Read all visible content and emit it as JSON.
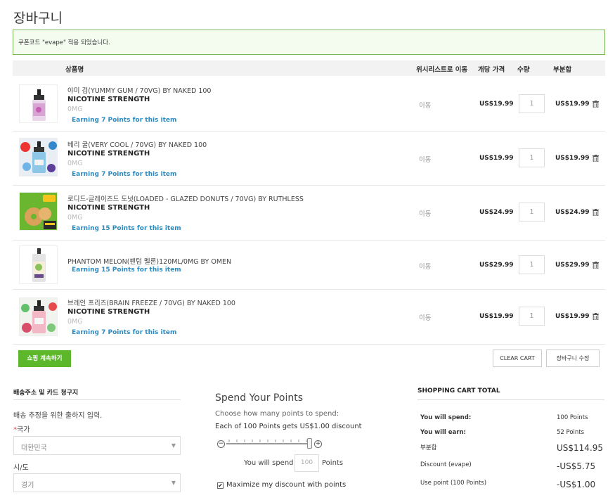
{
  "page": {
    "title": "장바구니"
  },
  "notice": {
    "text": "쿠폰코드 \"evape\" 적용 되었습니다."
  },
  "table": {
    "headers": {
      "product": "상품명",
      "wishlist": "위시리스트로 이동",
      "unit_price": "개당 가격",
      "qty": "수량",
      "subtotal": "부분합"
    }
  },
  "items": [
    {
      "name": "야미 검(YUMMY GUM / 70VG) BY NAKED 100",
      "option_label": "NICOTINE STRENGTH",
      "option_value": "0MG",
      "earn": "Earning 7 Points for this item",
      "move": "이동",
      "price": "US$19.99",
      "qty": "1",
      "subtotal": "US$19.99",
      "image": "pink-gum-bottle"
    },
    {
      "name": "베리 쿨(VERY COOL / 70VG) BY NAKED 100",
      "option_label": "NICOTINE STRENGTH",
      "option_value": "0MG",
      "earn": "Earning 7 Points for this item",
      "move": "이동",
      "price": "US$19.99",
      "qty": "1",
      "subtotal": "US$19.99",
      "image": "very-cool-bottle"
    },
    {
      "name": "로디드-글레이즈드 도넛(LOADED - GLAZED DONUTS / 70VG) BY RUTHLESS",
      "option_label": "NICOTINE STRENGTH",
      "option_value": "0MG",
      "earn": "Earning 15 Points for this item",
      "move": "이동",
      "price": "US$24.99",
      "qty": "1",
      "subtotal": "US$24.99",
      "image": "glazed-donuts-box"
    },
    {
      "name": "PHANTOM MELON(팬텀 멜론)120ML/0MG BY OMEN",
      "option_label": "",
      "option_value": "",
      "earn": "Earning 15 Points for this item",
      "move": "이동",
      "price": "US$29.99",
      "qty": "1",
      "subtotal": "US$29.99",
      "image": "phantom-melon-bottle"
    },
    {
      "name": "브레인 프리즈(BRAIN FREEZE / 70VG) BY NAKED 100",
      "option_label": "NICOTINE STRENGTH",
      "option_value": "0MG",
      "earn": "Earning 7 Points for this item",
      "move": "이동",
      "price": "US$19.99",
      "qty": "1",
      "subtotal": "US$19.99",
      "image": "brain-freeze-bottle"
    }
  ],
  "actions": {
    "continue": "쇼핑 계속하기",
    "clear": "CLEAR CART",
    "update": "장바구니 수정"
  },
  "shipping": {
    "title": "배송주소 및 카드 청구지",
    "desc": "배송 추정을 위한 출하지 입력.",
    "country_label": "국가",
    "country_req": "*",
    "country_value": "대한민국",
    "city_label": "시/도",
    "city_value": "경기"
  },
  "points": {
    "title": "Spend Your Points",
    "desc": "Choose how many points to spend:",
    "rate": "Each of 100 Points gets US$1.00 discount",
    "spend_label": "You will spend",
    "spend_value": "100",
    "spend_unit": "Points",
    "maximize_label": "Maximize my discount with points",
    "slider_level": 1.0
  },
  "totals": {
    "title": "SHOPPING CART TOTAL",
    "rows": [
      {
        "label": "You will spend:",
        "value": "100 Points"
      },
      {
        "label": "You will earn:",
        "value": "52 Points"
      },
      {
        "label": "부분합",
        "value": "US$114.95"
      },
      {
        "label": "Discount (evape)",
        "value": "-US$5.75"
      },
      {
        "label": "Use point (100 Points)",
        "value": "-US$1.00"
      }
    ]
  },
  "colors": {
    "accent_green": "#5cb82a",
    "link_blue": "#2e8bc0",
    "notice_border": "#7ab55c"
  }
}
